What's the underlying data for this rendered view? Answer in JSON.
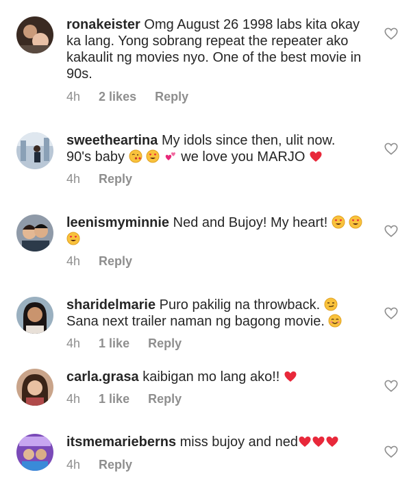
{
  "comments": [
    {
      "username": "ronakeister",
      "text": "Omg August 26 1998 labs kita okay ka lang. Yong sobrang repeat the repeater ako kakaulit ng movies nyo. One of the best movie in 90s.",
      "time": "4h",
      "likes": "2 likes",
      "reply": "Reply"
    },
    {
      "username": "sweetheartina",
      "text_line1": "My idols since then,  ulit now.",
      "text_line2a": "90's baby",
      "text_line2b": "we love you MARJO",
      "time": "4h",
      "reply": "Reply"
    },
    {
      "username": "leenismyminnie",
      "text": "Ned and Bujoy! My heart!",
      "time": "4h",
      "reply": "Reply"
    },
    {
      "username": "sharidelmarie",
      "text_line1": "Puro pakilig na throwback.",
      "text_line2": "Sana next trailer naman ng bagong movie.",
      "time": "4h",
      "likes": "1 like",
      "reply": "Reply"
    },
    {
      "username": "carla.grasa",
      "text": "kaibigan mo lang ako!!",
      "time": "4h",
      "likes": "1 like",
      "reply": "Reply"
    },
    {
      "username": "itsmemarieberns",
      "text": "miss bujoy and ned",
      "time": "4h",
      "reply": "Reply"
    }
  ],
  "colors": {
    "text": "#262626",
    "meta": "#8e8e8e",
    "heart_emoji": "#e8283a",
    "heart_icon": "#8e8e8e"
  },
  "icons": [
    "heart-icon",
    "heart-emoji",
    "kiss-emoji",
    "heart-eyes-emoji",
    "smirk-emoji",
    "smile-emoji",
    "two-hearts-emoji"
  ]
}
